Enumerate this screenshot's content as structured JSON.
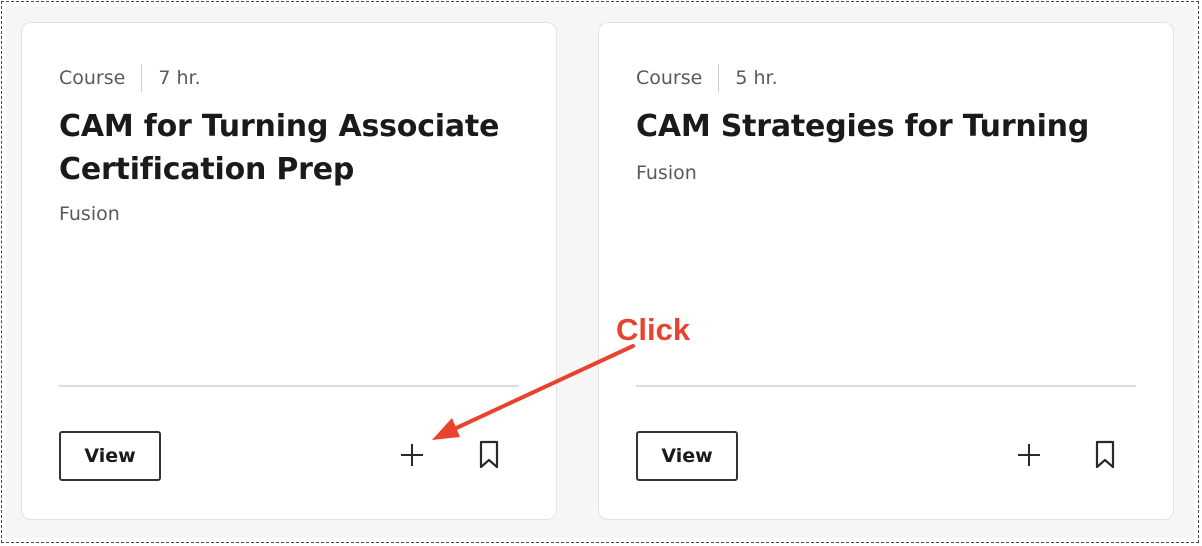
{
  "cards": [
    {
      "type": "Course",
      "duration": "7 hr.",
      "title": "CAM for Turning Associate Certification Prep",
      "product": "Fusion",
      "view_label": "View"
    },
    {
      "type": "Course",
      "duration": "5 hr.",
      "title": "CAM Strategies for Turning",
      "product": "Fusion",
      "view_label": "View"
    }
  ],
  "annotation": {
    "label": "Click",
    "color": "#e8432e"
  },
  "icons": {
    "add": "plus-icon",
    "bookmark": "bookmark-icon"
  }
}
